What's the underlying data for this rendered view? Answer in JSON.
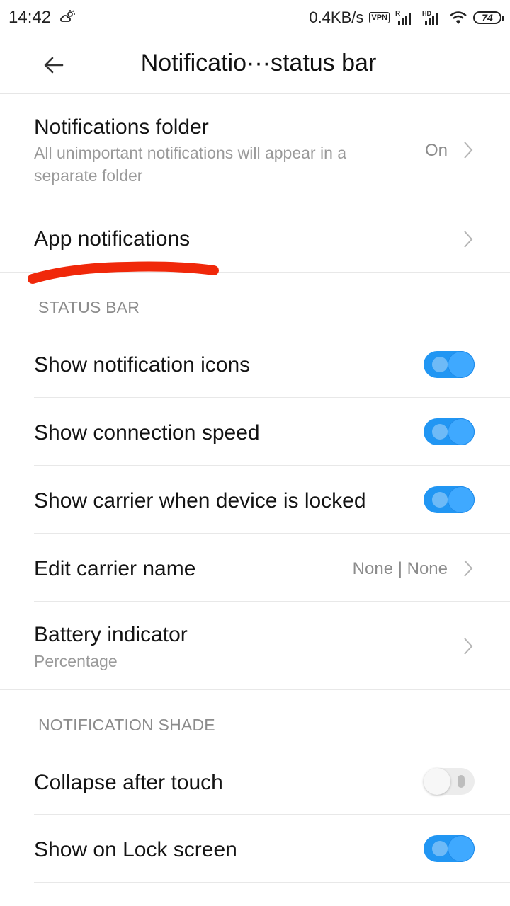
{
  "status_bar": {
    "time": "14:42",
    "speed": "0.4KB/s",
    "vpn": "VPN",
    "signal1_tag": "R",
    "signal2_tag": "HD",
    "battery": "74",
    "icons": [
      "weather-icon",
      "vpn-icon",
      "signal-icon",
      "hd-signal-icon",
      "wifi-icon",
      "battery-icon"
    ]
  },
  "header": {
    "title": "Notificatio···status  bar",
    "back_icon": "back-arrow-icon"
  },
  "items": {
    "notifications_folder": {
      "title": "Notifications folder",
      "subtitle": "All unimportant notifications will appear in a separate folder",
      "value": "On"
    },
    "app_notifications": {
      "title": "App notifications"
    },
    "status_bar_section": "STATUS BAR",
    "show_notification_icons": {
      "title": "Show notification icons",
      "enabled": true
    },
    "show_connection_speed": {
      "title": "Show connection speed",
      "enabled": true
    },
    "show_carrier_locked": {
      "title": "Show carrier when device is locked",
      "enabled": true
    },
    "edit_carrier_name": {
      "title": "Edit carrier name",
      "value": "None | None"
    },
    "battery_indicator": {
      "title": "Battery indicator",
      "subtitle": "Percentage"
    },
    "notification_shade_section": "NOTIFICATION SHADE",
    "collapse_after_touch": {
      "title": "Collapse after touch",
      "enabled": false
    },
    "show_on_lock_screen": {
      "title": "Show on Lock screen",
      "enabled": true
    }
  },
  "colors": {
    "toggle_on": "#2196f3",
    "toggle_off": "#ececec",
    "annotation": "#f0280a"
  }
}
